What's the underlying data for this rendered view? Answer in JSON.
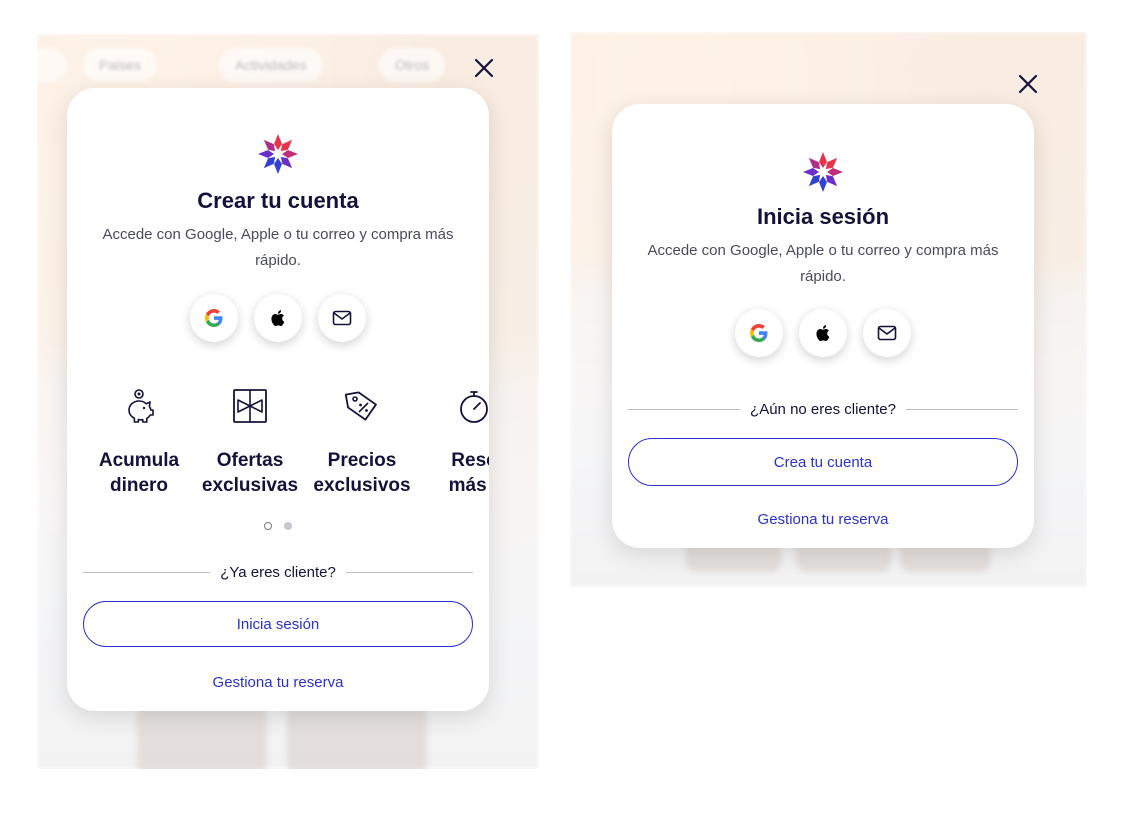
{
  "colors": {
    "brand_blue": "#2b31c9",
    "text_dark": "#14123a",
    "text_muted": "#4a4a5e",
    "logo_red": "#e8344a",
    "logo_purple": "#6a2fc9",
    "logo_blue": "#3340d6"
  },
  "background": {
    "filters": [
      "Paises",
      "Actividades",
      "Otros"
    ]
  },
  "signup_modal": {
    "close_icon": "close-icon",
    "logo_icon": "brand-logo-icon",
    "title": "Crear tu cuenta",
    "subtitle": "Accede con Google, Apple o tu correo y compra más rápido.",
    "social": [
      {
        "name": "Google",
        "icon": "google-icon"
      },
      {
        "name": "Apple",
        "icon": "apple-icon"
      },
      {
        "name": "Correo",
        "icon": "mail-icon"
      }
    ],
    "benefits": [
      {
        "label": "Acumula\ndinero",
        "icon": "piggy-bank-icon"
      },
      {
        "label": "Ofertas\nexclusivas",
        "icon": "gift-icon"
      },
      {
        "label": "Precios\nexclusivos",
        "icon": "price-tag-icon"
      },
      {
        "label": "Rese\nmás r",
        "icon": "stopwatch-icon"
      }
    ],
    "carousel": {
      "pages": 2,
      "active": 1
    },
    "divider_text": "¿Ya eres cliente?",
    "primary_button": "Inicia sesión",
    "link": "Gestiona tu reserva"
  },
  "login_modal": {
    "close_icon": "close-icon",
    "logo_icon": "brand-logo-icon",
    "title": "Inicia sesión",
    "subtitle": "Accede con Google, Apple o tu correo y compra más rápido.",
    "social": [
      {
        "name": "Google",
        "icon": "google-icon"
      },
      {
        "name": "Apple",
        "icon": "apple-icon"
      },
      {
        "name": "Correo",
        "icon": "mail-icon"
      }
    ],
    "divider_text": "¿Aún no eres cliente?",
    "primary_button": "Crea tu cuenta",
    "link": "Gestiona tu reserva"
  }
}
